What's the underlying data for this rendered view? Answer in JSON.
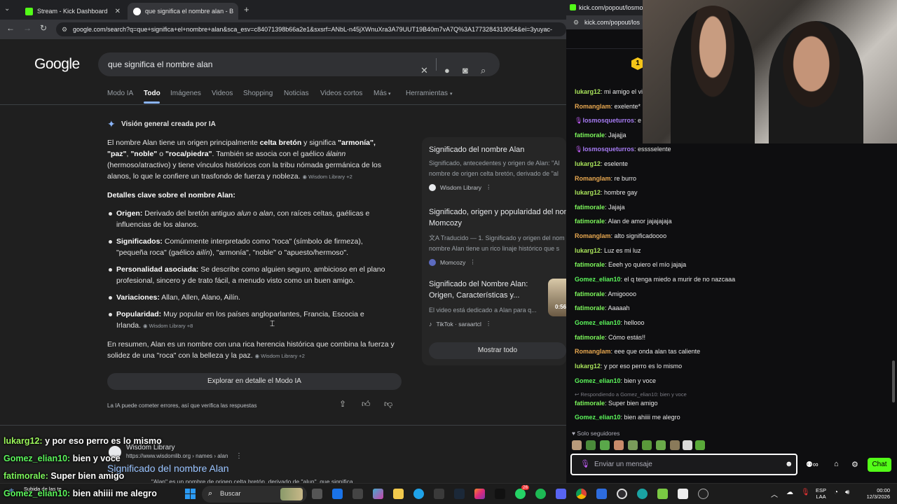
{
  "browser": {
    "tabs": [
      {
        "label": "Stream - Kick Dashboard"
      },
      {
        "label": "que significa el nombre alan - B"
      }
    ],
    "url": "google.com/search?q=que+significa+el+nombre+alan&sca_esv=c84071398b66a2e1&sxsrf=ANbL-n45jXWnuXra3A79UUT19B40m7vA7Q%3A1773284319054&ei=3yuyac-"
  },
  "google": {
    "logo": "Google",
    "query": "que significa el nombre alan",
    "tabs": [
      "Modo IA",
      "Todo",
      "Imágenes",
      "Videos",
      "Shopping",
      "Noticias",
      "Videos cortos",
      "Más",
      "Herramientas"
    ],
    "active_tab": "Todo",
    "ai": {
      "heading": "Visión general creada por IA",
      "intro_1": "El nombre Alan tiene un origen principalmente ",
      "intro_b1": "celta bretón",
      "intro_2": " y significa ",
      "intro_b2": "\"armonía\",",
      "intro_line2_b1": "\"paz\"",
      "intro_line2_a": ", ",
      "intro_line2_b2": "\"noble\"",
      "intro_line2_c": " o ",
      "intro_line2_b3": "\"roca/piedra\"",
      "intro_line2_d": ". También se asocia con el gaélico ",
      "intro_line2_i": "álainn",
      "intro_line3": "(hermoso/atractivo) y tiene vínculos históricos con la tribu nómada germánica de los",
      "intro_line4": "alanos, lo que le confiere un trasfondo de fuerza y nobleza.",
      "intro_src": "Wisdom Library +2",
      "details_heading": "Detalles clave sobre el nombre Alan:",
      "b_origen_label": "Origen:",
      "b_origen_1": " Derivado del bretón antiguo ",
      "b_origen_i1": "alun",
      "b_origen_2": " o ",
      "b_origen_i2": "alan",
      "b_origen_3": ", con raíces celtas, gaélicas e",
      "b_origen_line2": "influencias de los alanos.",
      "b_sig_label": "Significados:",
      "b_sig_1": " Comúnmente interpretado como \"roca\" (símbolo de firmeza),",
      "b_sig_line2a": "\"pequeña roca\" (gaélico ",
      "b_sig_line2i": "ailín",
      "b_sig_line2b": "), \"armonía\", \"noble\" o \"apuesto/hermoso\".",
      "b_per_label": "Personalidad asociada:",
      "b_per_1": " Se describe como alguien seguro, ambicioso en el plano",
      "b_per_line2": "profesional, sincero y de trato fácil, a menudo visto como un buen amigo.",
      "b_var_label": "Variaciones:",
      "b_var_1": " Allan, Allen, Alano, Ailín.",
      "b_pop_label": "Popularidad:",
      "b_pop_1": " Muy popular en los países angloparlantes, Francia, Escocia e",
      "b_pop_line2": "Irlanda.",
      "b_pop_src": "Wisdom Library +8",
      "summary_1": "En resumen, Alan es un nombre con una rica herencia histórica que combina la fuerza y",
      "summary_2": "solidez de una \"roca\" con la belleza y la paz.",
      "summary_src": "Wisdom Library +2",
      "explore_btn": "Explorar en detalle el Modo IA",
      "disclaimer": "La IA puede cometer errores, así que verifica las respuestas"
    },
    "sources": [
      {
        "title": "Significado del nombre Alan",
        "sub1": "Significado, antecedentes y origen de Alan: \"Al",
        "sub2": "nombre de origen celta bretón, derivado de \"al",
        "site": "Wisdom Library"
      },
      {
        "title": "Significado, origen y popularidad del nom",
        "title2": "Momcozy",
        "sub1": "Traducido — 1. Significado y origen del nom",
        "sub2": "nombre Alan tiene un rico linaje histórico que s",
        "site": "Momcozy"
      },
      {
        "title": "Significado del Nombre Alan:",
        "title2": "Origen, Características y...",
        "sub1": "El video está dedicado a Alan para q...",
        "site": "TikTok · saraartcl",
        "duration": "0:56"
      }
    ],
    "show_all": "Mostrar todo",
    "result": {
      "site": "Wisdom Library",
      "url": "https://www.wisdomlib.org › names › alan",
      "title": "Significado del nombre Alan",
      "snippet": "\"Alan\" es un nombre de origen celta bretón, derivado de \"alun\", que significa"
    }
  },
  "overlay_chat": [
    {
      "user": "lukarg12:",
      "text": " y por eso perro es lo mismo",
      "color": "#9cf75b"
    },
    {
      "user": "Gomez_elian10:",
      "text": " bien y voce",
      "color": "#5bf55b"
    },
    {
      "user": "fatimorale:",
      "text": " Super bien amigo",
      "color": "#7cf55b"
    },
    {
      "user": "Gomez_elian10:",
      "text": " bien ahiiii me alegro",
      "color": "#5bf55b"
    }
  ],
  "kick": {
    "window_title": "kick.com/popout/losmosq",
    "url": "kick.com/popout/los",
    "badge": "1",
    "messages": [
      {
        "user": "lukarg12",
        "text": ": mi amigo el vi",
        "color": "#a8e25a"
      },
      {
        "user": "Romanglam",
        "text": ": exelente*",
        "color": "#e8a850"
      },
      {
        "user": "losmosqueturros",
        "text": ": e",
        "color": "#a77cf5",
        "mic": true
      },
      {
        "user": "fatimorale",
        "text": ": Jajajja",
        "color": "#7cf55b"
      },
      {
        "user": "losmosqueturros",
        "text": ": esssselente",
        "color": "#a77cf5",
        "mic": true
      },
      {
        "user": "lukarg12",
        "text": ": eselente",
        "color": "#a8e25a"
      },
      {
        "user": "Romanglam",
        "text": ": re burro",
        "color": "#e8a850"
      },
      {
        "user": "lukarg12",
        "text": ": hombre gay",
        "color": "#a8e25a"
      },
      {
        "user": "fatimorale",
        "text": ": Jajaja",
        "color": "#7cf55b"
      },
      {
        "user": "fatimorale",
        "text": ": Alan de amor jajajajaja",
        "color": "#7cf55b"
      },
      {
        "user": "Romanglam",
        "text": ": alto significadoooo",
        "color": "#e8a850"
      },
      {
        "user": "lukarg12",
        "text": ": Luz es mi luz",
        "color": "#a8e25a"
      },
      {
        "user": "fatimorale",
        "text": ": Eeeh yo quiero el mío jajaja",
        "color": "#7cf55b"
      },
      {
        "user": "Gomez_elian10",
        "text": ": el q tenga miedo a murir de no nazcaaa",
        "color": "#5bf55b"
      },
      {
        "user": "fatimorale",
        "text": ": Amigoooo",
        "color": "#7cf55b"
      },
      {
        "user": "fatimorale",
        "text": ": Aaaaah",
        "color": "#7cf55b"
      },
      {
        "user": "Gomez_elian10",
        "text": ": hellooo",
        "color": "#5bf55b"
      },
      {
        "user": "fatimorale",
        "text": ": Cómo estás!!",
        "color": "#7cf55b"
      },
      {
        "user": "Romanglam",
        "text": ": eee que onda alan tas caliente",
        "color": "#e8a850"
      },
      {
        "user": "lukarg12",
        "text": ": y por eso perro es lo mismo",
        "color": "#a8e25a"
      },
      {
        "user": "Gomez_elian10",
        "text": ": bien y voce",
        "color": "#5bf55b"
      }
    ],
    "reply_note": "Respondiendo a Gomez_elian10: bien y voce",
    "after_reply": [
      {
        "user": "fatimorale",
        "text": ": Super bien amigo",
        "color": "#7cf55b"
      },
      {
        "user": "Gomez_elian10",
        "text": ": bien ahiiii me alegro",
        "color": "#5bf55b"
      }
    ],
    "followers_only": "Solo seguidores",
    "input_placeholder": "Enviar un mensaje",
    "chat_button": "Chat"
  },
  "taskbar": {
    "weather_1": "Subida de las te",
    "search": "Buscar",
    "lang_1": "ESP",
    "lang_2": "LAA",
    "time": "00:00",
    "date": "12/3/2026",
    "badge_count": "26"
  }
}
